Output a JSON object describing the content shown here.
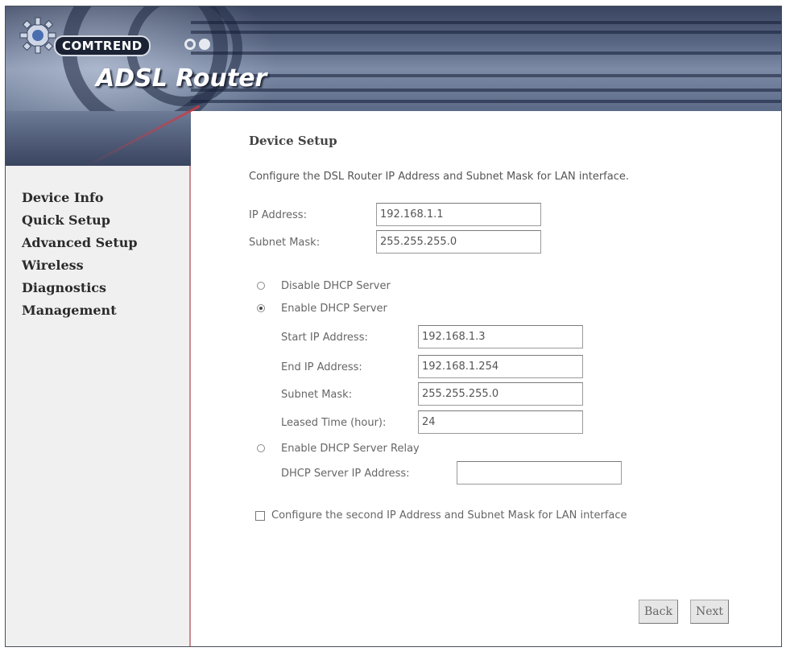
{
  "header": {
    "brand": "COMTREND",
    "product": "ADSL Router"
  },
  "sidebar": {
    "items": [
      {
        "label": "Device Info"
      },
      {
        "label": "Quick Setup"
      },
      {
        "label": "Advanced Setup"
      },
      {
        "label": "Wireless"
      },
      {
        "label": "Diagnostics"
      },
      {
        "label": "Management"
      }
    ]
  },
  "main": {
    "title": "Device Setup",
    "description": "Configure the DSL Router IP Address and Subnet Mask for LAN interface.",
    "ip_address": {
      "label": "IP Address:",
      "value": "192.168.1.1"
    },
    "subnet_mask": {
      "label": "Subnet Mask:",
      "value": "255.255.255.0"
    },
    "dhcp": {
      "disable_label": "Disable DHCP Server",
      "enable_label": "Enable DHCP Server",
      "relay_label": "Enable DHCP Server Relay",
      "selected": "enable",
      "start_ip": {
        "label": "Start IP Address:",
        "value": "192.168.1.3"
      },
      "end_ip": {
        "label": "End IP Address:",
        "value": "192.168.1.254"
      },
      "subnet_mask": {
        "label": "Subnet Mask:",
        "value": "255.255.255.0"
      },
      "lease_time": {
        "label": "Leased Time (hour):",
        "value": "24"
      },
      "relay_server_ip": {
        "label": "DHCP Server IP Address:",
        "value": ""
      }
    },
    "second_ip_label": "Configure the second IP Address and Subnet Mask for LAN interface",
    "second_ip_checked": false,
    "buttons": {
      "back": "Back",
      "next": "Next"
    }
  }
}
